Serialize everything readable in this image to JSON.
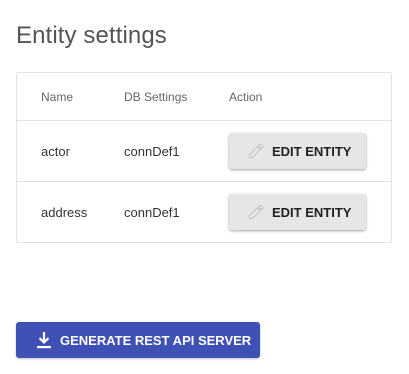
{
  "page": {
    "title": "Entity settings"
  },
  "table": {
    "headers": {
      "name": "Name",
      "db_settings": "DB Settings",
      "action": "Action"
    },
    "rows": [
      {
        "name": "actor",
        "db_settings": "connDef1",
        "action_label": "EDIT ENTITY",
        "action_icon": "pencil-icon"
      },
      {
        "name": "address",
        "db_settings": "connDef1",
        "action_label": "EDIT ENTITY",
        "action_icon": "pencil-icon"
      }
    ]
  },
  "generate_button": {
    "label": "GENERATE REST API SERVER",
    "icon": "download-icon",
    "color": "#3f51b5"
  }
}
